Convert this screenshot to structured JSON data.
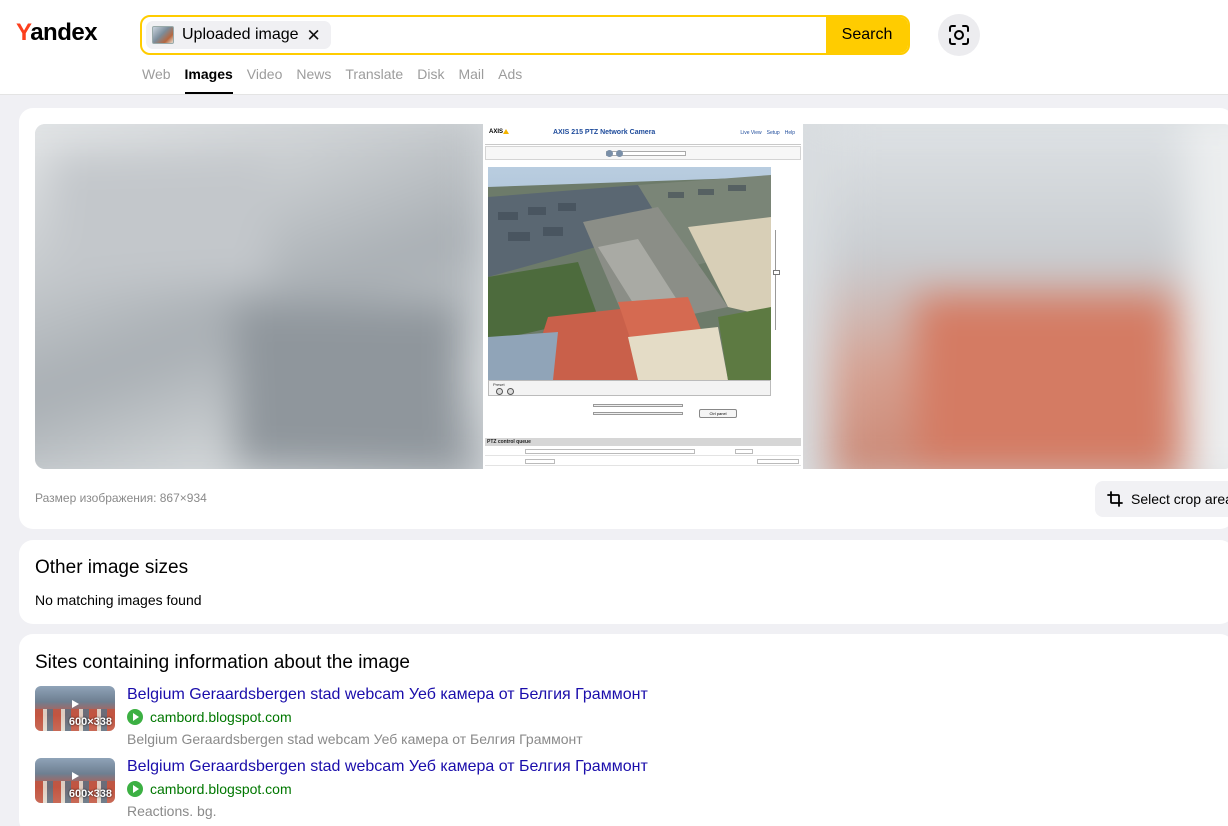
{
  "header": {
    "logo_first": "Y",
    "logo_rest": "andex",
    "chip_label": "Uploaded image",
    "chip_close": "✕",
    "search_label": "Search",
    "nav": [
      {
        "label": "Web",
        "active": false
      },
      {
        "label": "Images",
        "active": true
      },
      {
        "label": "Video",
        "active": false
      },
      {
        "label": "News",
        "active": false
      },
      {
        "label": "Translate",
        "active": false
      },
      {
        "label": "Disk",
        "active": false
      },
      {
        "label": "Mail",
        "active": false
      },
      {
        "label": "Ads",
        "active": false
      }
    ]
  },
  "preview": {
    "screenshot_title": "AXIS 215 PTZ Network Camera",
    "screenshot_logo": "AXIS",
    "screenshot_menu": [
      "Live View",
      "Setup",
      "Help"
    ],
    "screenshot_tab": "Preset",
    "screenshot_button": "Ctrl panel",
    "screenshot_section": "PTZ control queue",
    "size_label": "Размер изображения: 867×934",
    "crop_label": "Select crop area"
  },
  "other_sizes": {
    "title": "Other image sizes",
    "note": "No matching images found"
  },
  "sites": {
    "title": "Sites containing information about the image",
    "items": [
      {
        "title": "Belgium Geraardsbergen stad webcam Уеб камера от Белгия Граммонт",
        "host": "cambord.blogspot.com",
        "description": "Belgium Geraardsbergen stad webcam Уеб камера от Белгия Граммонт",
        "thumb_size": "600×338"
      },
      {
        "title": "Belgium Geraardsbergen stad webcam Уеб камера от Белгия Граммонт",
        "host": "cambord.blogspot.com",
        "description": "Reactions. bg.",
        "thumb_size": "600×338"
      }
    ]
  },
  "colors": {
    "accent": "#ffcc00",
    "logo_red": "#fc3f1d",
    "link": "#1a0dab",
    "host_green": "#007700"
  },
  "icons": {
    "camera_lens": "lens-search-icon",
    "crop": "crop-icon",
    "favicon": "play-favicon-icon"
  }
}
